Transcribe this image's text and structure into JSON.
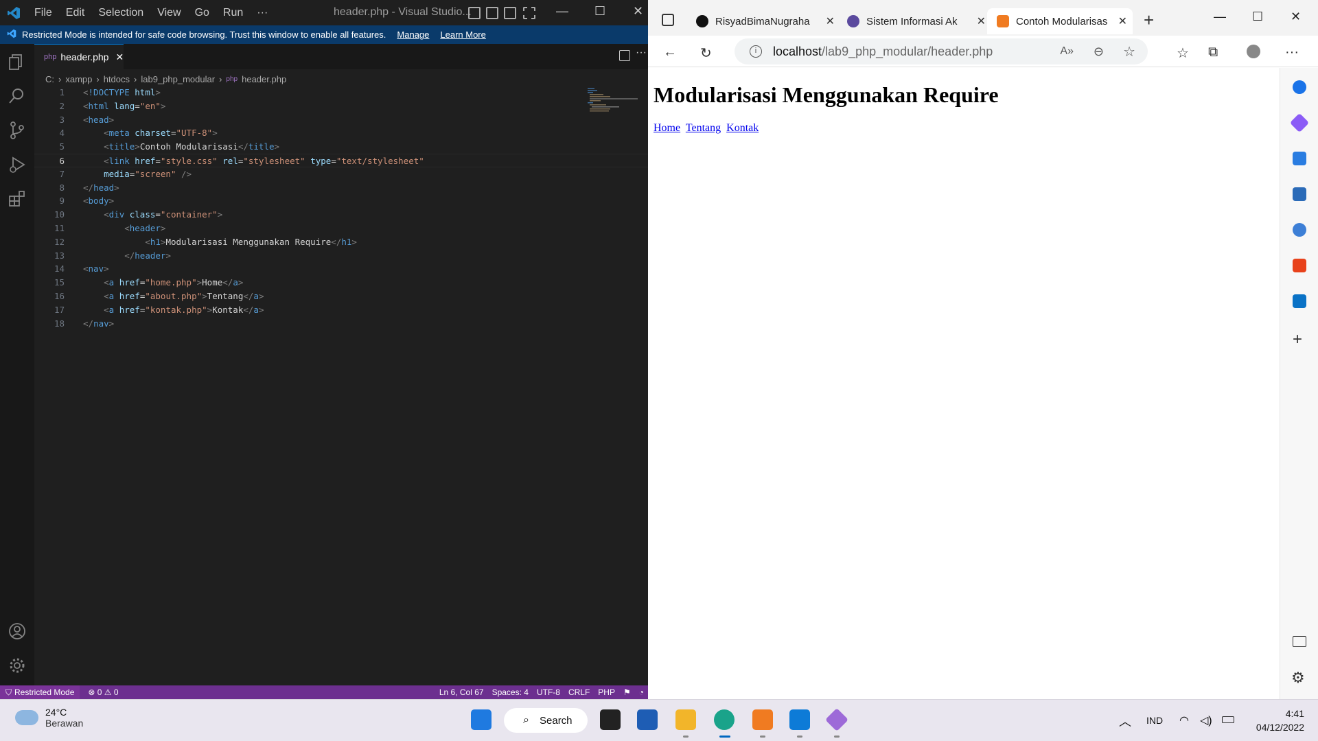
{
  "vscode": {
    "menu": [
      "File",
      "Edit",
      "Selection",
      "View",
      "Go",
      "Run",
      "···"
    ],
    "title": "header.php - Visual Studio...",
    "banner": {
      "text": "Restricted Mode is intended for safe code browsing. Trust this window to enable all features.",
      "manage": "Manage",
      "learn_more": "Learn More"
    },
    "tab": {
      "label": "header.php"
    },
    "breadcrumb": [
      "C:",
      "xampp",
      "htdocs",
      "lab9_php_modular",
      "header.php"
    ],
    "code_lines": [
      {
        "n": "1",
        "text": "<!DOCTYPE html>"
      },
      {
        "n": "2",
        "text": "<html lang=\"en\">"
      },
      {
        "n": "3",
        "text": "<head>"
      },
      {
        "n": "4",
        "text": "    <meta charset=\"UTF-8\">"
      },
      {
        "n": "5",
        "text": "    <title>Contoh Modularisasi</title>"
      },
      {
        "n": "6",
        "text": "    <link href=\"style.css\" rel=\"stylesheet\" type=\"text/stylesheet\""
      },
      {
        "n": "7",
        "text": "    media=\"screen\" />"
      },
      {
        "n": "8",
        "text": "</head>"
      },
      {
        "n": "9",
        "text": "<body>"
      },
      {
        "n": "10",
        "text": "    <div class=\"container\">"
      },
      {
        "n": "11",
        "text": "        <header>"
      },
      {
        "n": "12",
        "text": "            <h1>Modularisasi Menggunakan Require</h1>"
      },
      {
        "n": "13",
        "text": "        </header>"
      },
      {
        "n": "14",
        "text": "<nav>"
      },
      {
        "n": "15",
        "text": "    <a href=\"home.php\">Home</a>"
      },
      {
        "n": "16",
        "text": "    <a href=\"about.php\">Tentang</a>"
      },
      {
        "n": "17",
        "text": "    <a href=\"kontak.php\">Kontak</a>"
      },
      {
        "n": "18",
        "text": "</nav>"
      }
    ],
    "status": {
      "restricted": "Restricted Mode",
      "problems": "⊗ 0 ⚠ 0",
      "position": "Ln 6, Col 67",
      "spaces": "Spaces: 4",
      "encoding": "UTF-8",
      "eol": "CRLF",
      "language": "PHP"
    }
  },
  "edge": {
    "tabs": [
      {
        "label": "RisyadBimaNugraha"
      },
      {
        "label": "Sistem Informasi Ak"
      },
      {
        "label": "Contoh Modularisas"
      }
    ],
    "address": {
      "host": "localhost",
      "path": "/lab9_php_modular/header.php"
    },
    "page": {
      "heading": "Modularisasi Menggunakan Require",
      "links": [
        "Home",
        "Tentang",
        "Kontak"
      ]
    }
  },
  "taskbar": {
    "weather": {
      "temp": "24°C",
      "condition": "Berawan"
    },
    "search": "Search",
    "language": "IND",
    "time": "4:41",
    "date": "04/12/2022"
  },
  "colors": {
    "vscode_status": "#6c2f8f",
    "banner": "#0a3a6a",
    "link": "#0000ee"
  }
}
